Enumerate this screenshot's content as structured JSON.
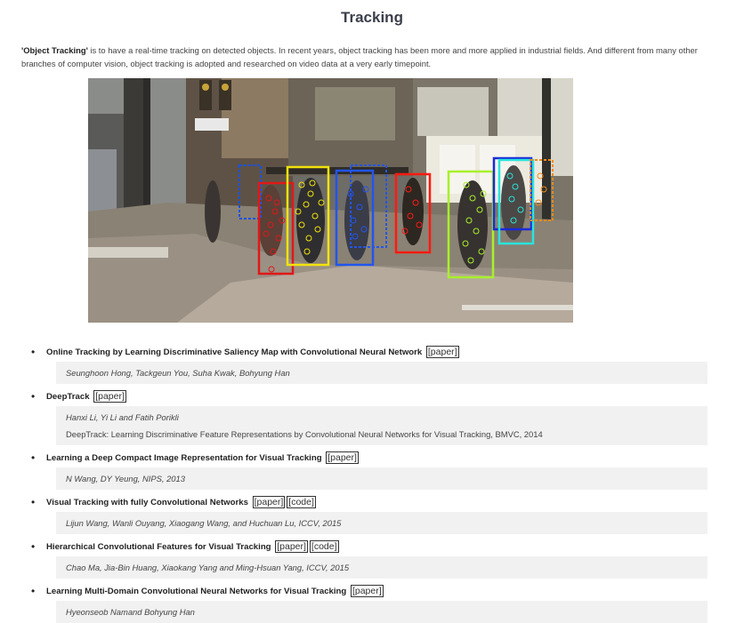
{
  "page": {
    "title": "Tracking",
    "intro_bold": "'Object Tracking'",
    "intro_text": " is to have a real-time tracking on detected objects. In recent years, object tracking has been more and more applied in industrial fields. And different from many other branches of computer vision, object tracking is adopted and researched on video data at a very early timepoint."
  },
  "figure": {
    "description_name": "street-tracking-image",
    "box_colors": [
      "#1a52e8",
      "#e01818",
      "#f2e20e",
      "#2255ee",
      "#ff1a10",
      "#a8f02a",
      "#1a2ad8",
      "#28e4dc",
      "#f28a18"
    ]
  },
  "papers": [
    {
      "title": "Online Tracking by Learning Discriminative Saliency Map with Convolutional Neural Network",
      "links": [
        "[paper]"
      ],
      "italic": true,
      "details": [
        "Seunghoon Hong, Tackgeun You, Suha Kwak, Bohyung Han"
      ]
    },
    {
      "title": "DeepTrack",
      "links": [
        "[paper]"
      ],
      "italic": false,
      "details": [
        "Hanxi Li, Yi Li and Fatih Porikli",
        "DeepTrack: Learning Discriminative Feature Representations by Convolutional Neural Networks for Visual Tracking, BMVC, 2014"
      ]
    },
    {
      "title": "Learning a Deep Compact Image Representation for Visual Tracking",
      "links": [
        "[paper]"
      ],
      "italic": true,
      "details": [
        "N Wang, DY Yeung, NIPS, 2013"
      ]
    },
    {
      "title": "Visual Tracking with fully Convolutional Networks",
      "links": [
        "[paper]",
        "[code]"
      ],
      "italic": true,
      "details": [
        "Lijun Wang, Wanli Ouyang, Xiaogang Wang, and Huchuan Lu, ICCV, 2015"
      ]
    },
    {
      "title": "Hierarchical Convolutional Features for Visual Tracking",
      "links": [
        "[paper]",
        "[code]"
      ],
      "italic": true,
      "details": [
        "Chao Ma, Jia-Bin Huang, Xiaokang Yang and Ming-Hsuan Yang, ICCV, 2015"
      ]
    },
    {
      "title": "Learning Multi-Domain Convolutional Neural Networks for Visual Tracking",
      "links": [
        "[paper]"
      ],
      "italic": true,
      "details": [
        "Hyeonseob Namand Bohyung Han"
      ]
    }
  ]
}
